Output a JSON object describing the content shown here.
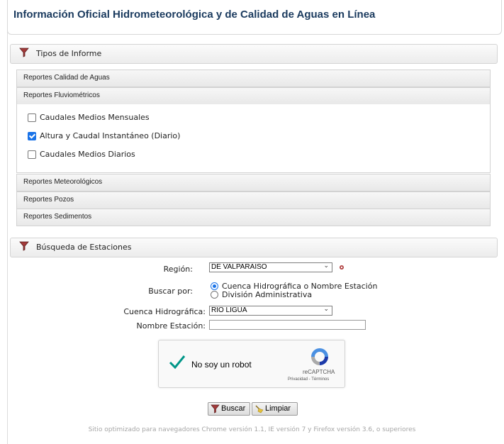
{
  "header": {
    "title": "Información Oficial Hidrometeorológica y de Calidad de Aguas en Línea"
  },
  "sections": {
    "report_types": {
      "label": "Tipos de Informe",
      "icon": "filter-funnel-icon"
    },
    "station_search": {
      "label": "Búsqueda de Estaciones",
      "icon": "filter-funnel-icon"
    }
  },
  "accordion": {
    "items": [
      {
        "label": "Reportes Calidad de Aguas"
      },
      {
        "label": "Reportes Fluviométricos"
      },
      {
        "label": "Reportes Meteorológicos"
      },
      {
        "label": "Reportes Pozos"
      },
      {
        "label": "Reportes Sedimentos"
      }
    ],
    "fluviometric_options": [
      {
        "label": "Caudales Medios Mensuales",
        "checked": false
      },
      {
        "label": "Altura y Caudal Instantáneo (Diario)",
        "checked": true
      },
      {
        "label": "Caudales Medios Diarios",
        "checked": false
      }
    ]
  },
  "search_form": {
    "region_label": "Región:",
    "region_value": "DE VALPARAISO",
    "search_by_label": "Buscar por:",
    "search_by_options": [
      {
        "label": "Cuenca Hidrográfica o Nombre Estación",
        "selected": true
      },
      {
        "label": "División Administrativa",
        "selected": false
      }
    ],
    "basin_label": "Cuenca Hidrográfica:",
    "basin_value": "RIO LIGUA",
    "station_name_label": "Nombre Estación:",
    "station_name_value": ""
  },
  "captcha": {
    "label": "No soy un robot",
    "brand": "reCAPTCHA",
    "privacy": "Privacidad",
    "separator": " - ",
    "terms": "Términos"
  },
  "buttons": {
    "search_label": "Buscar",
    "clear_label": "Limpiar"
  },
  "footer": {
    "note": "Sitio optimizado para navegadores Chrome versión 1.1, IE versión 7 y Firefox versión 3.6, o superiores"
  },
  "colors": {
    "title": "#1a3a5e",
    "accent": "#1a73e8",
    "captcha_check": "#009688",
    "icon_red": "#a33a3a"
  }
}
